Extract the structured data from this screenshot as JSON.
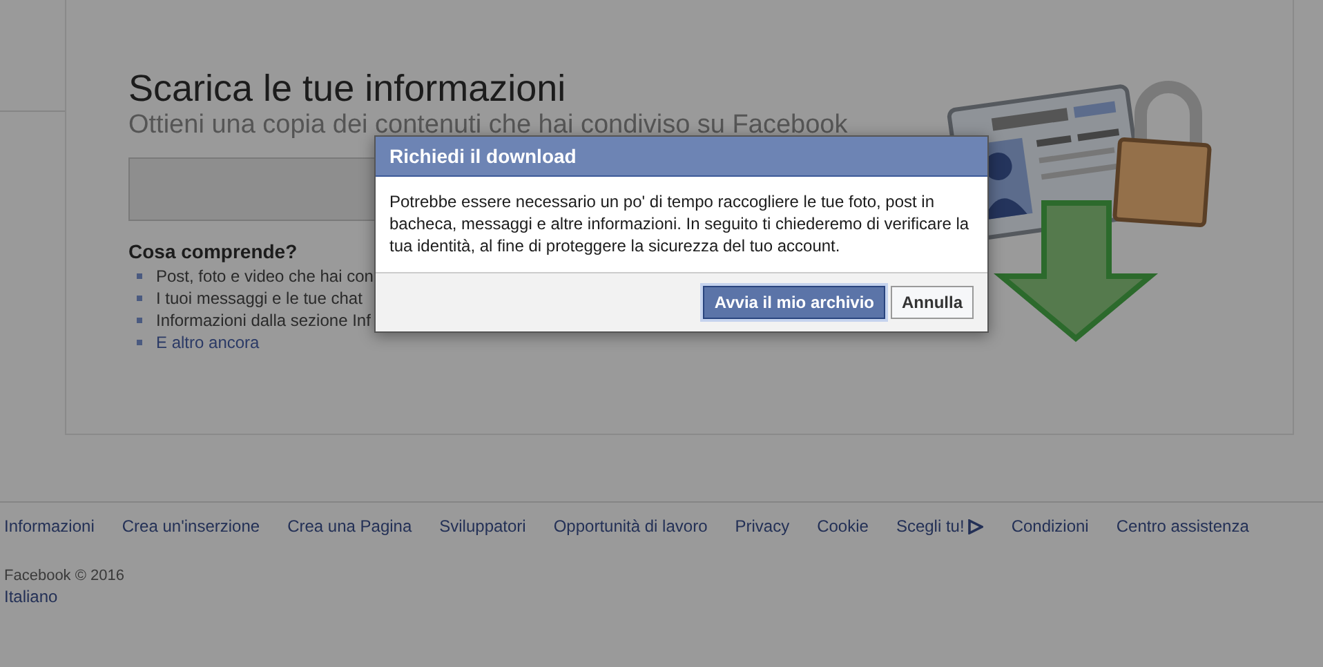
{
  "page": {
    "title": "Scarica le tue informazioni",
    "subtitle": "Ottieni una copia dei contenuti che hai condiviso su Facebook",
    "section_heading": "Cosa comprende?",
    "items": [
      {
        "text": "Post, foto e video che hai con",
        "kind": "text"
      },
      {
        "text": "I tuoi messaggi e le tue chat",
        "kind": "text"
      },
      {
        "text": "Informazioni dalla sezione Inf",
        "kind": "text"
      },
      {
        "text": "E altro ancora",
        "kind": "link"
      }
    ]
  },
  "dialog": {
    "title": "Richiedi il download",
    "message": "Potrebbe essere necessario un po' di tempo raccogliere le tue foto, post in bacheca, messaggi e altre informazioni. In seguito ti chiederemo di verificare la tua identità, al fine di proteggere la sicurezza del tuo account.",
    "buttons": [
      {
        "label": "Avvia il mio archivio",
        "kind": "primary"
      },
      {
        "label": "Annulla",
        "kind": "secondary"
      }
    ]
  },
  "footer": {
    "links": [
      {
        "label": "Informazioni"
      },
      {
        "label": "Crea un'inserzione"
      },
      {
        "label": "Crea una Pagina"
      },
      {
        "label": "Sviluppatori"
      },
      {
        "label": "Opportunità di lavoro"
      },
      {
        "label": "Privacy"
      },
      {
        "label": "Cookie"
      },
      {
        "label": "Scegli tu!",
        "icon": true
      },
      {
        "label": "Condizioni"
      },
      {
        "label": "Centro assistenza"
      }
    ],
    "copyright": "Facebook © 2016",
    "language": "Italiano"
  }
}
